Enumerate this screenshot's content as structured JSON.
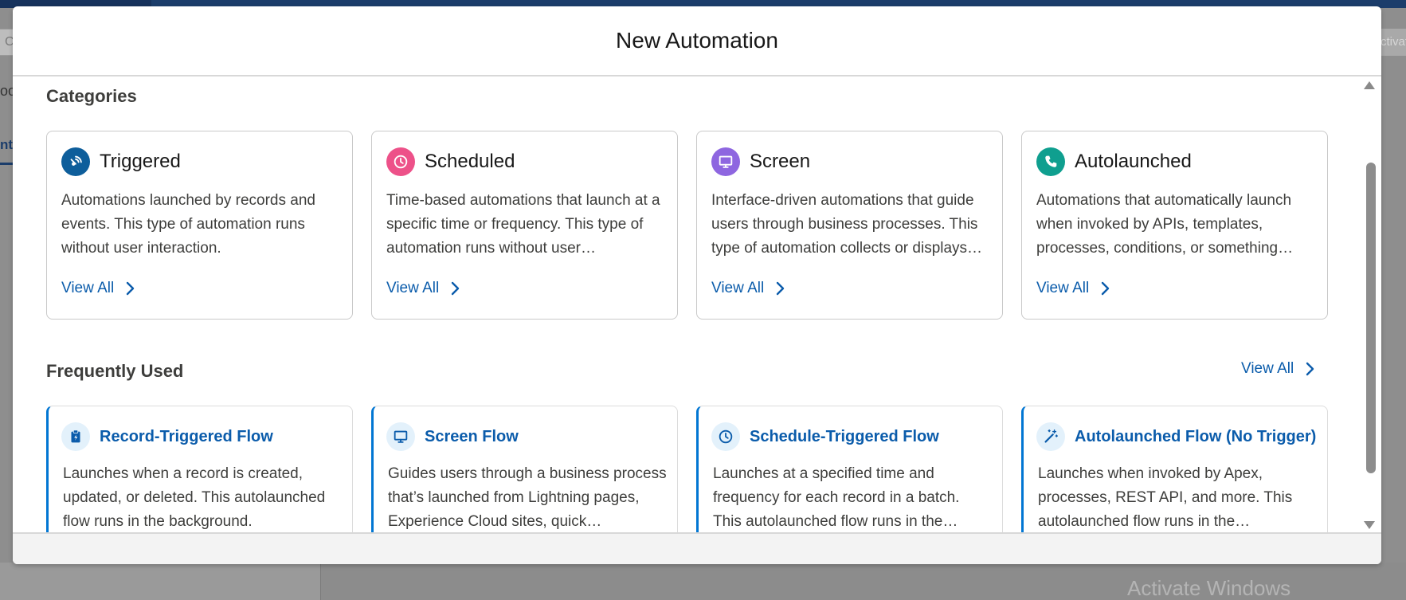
{
  "background": {
    "search_fragment": "C",
    "activate_fragment": "ctivat",
    "side_text_a": "oo",
    "side_text_b": "nts",
    "watermark": "Activate Windows"
  },
  "modal": {
    "title": "New Automation"
  },
  "categories": {
    "heading": "Categories",
    "items": [
      {
        "title": "Triggered",
        "icon": "broadcast-icon",
        "icon_color": "#0e5e9b",
        "description": "Automations launched by records and events. This type of automation runs without user interaction.",
        "link": "View All"
      },
      {
        "title": "Scheduled",
        "icon": "clock-icon",
        "icon_color": "#ed5189",
        "description": "Time-based automations that launch at a specific time or frequency. This type of automation runs without user…",
        "link": "View All"
      },
      {
        "title": "Screen",
        "icon": "monitor-icon",
        "icon_color": "#8e66e0",
        "description": "Interface-driven automations that guide users through business processes. This type of automation collects or displays…",
        "link": "View All"
      },
      {
        "title": "Autolaunched",
        "icon": "phone-icon",
        "icon_color": "#0f9f8f",
        "description": "Automations that automatically launch when invoked by APIs, templates, processes, conditions, or something…",
        "link": "View All"
      }
    ]
  },
  "frequently_used": {
    "heading": "Frequently Used",
    "view_all": "View All",
    "items": [
      {
        "title": "Record-Triggered Flow",
        "icon": "clipboard-icon",
        "description": "Launches when a record is created, updated, or deleted. This autolaunched flow runs in the background."
      },
      {
        "title": "Screen Flow",
        "icon": "monitor-icon",
        "description": "Guides users through a business process that’s launched from Lightning pages, Experience Cloud sites, quick…"
      },
      {
        "title": "Schedule-Triggered Flow",
        "icon": "clock-icon",
        "description": "Launches at a specified time and frequency for each record in a batch. This autolaunched flow runs in the…"
      },
      {
        "title": "Autolaunched Flow (No Trigger)",
        "icon": "magic-wand-icon",
        "description": "Launches when invoked by Apex, processes, REST API, and more. This autolaunched flow runs in the…"
      }
    ]
  },
  "colors": {
    "link": "#0b5cab",
    "accent": "#0176d3",
    "frequent_icon": "#0b5cab"
  }
}
